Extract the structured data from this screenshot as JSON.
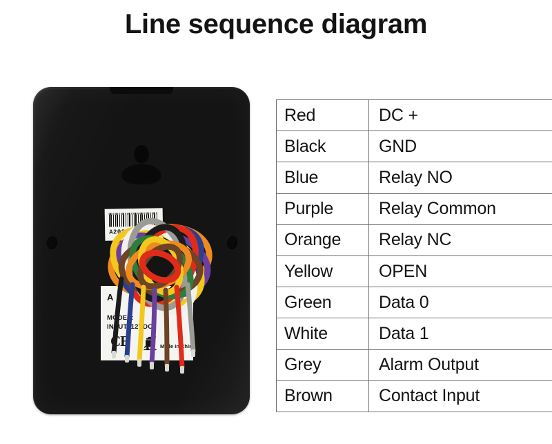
{
  "title": "Line sequence diagram",
  "device": {
    "name": "access-control-reader-back",
    "body_color": "#141414",
    "barcode_label": {
      "serial": "A202"
    },
    "spec_label": {
      "brand": "A",
      "model": "MODEL:",
      "input": "INPUT: 12VDC",
      "ce_mark": "CE",
      "weee_icon": "crossed-out-wheelie-bin-icon",
      "origin": "Made in China"
    },
    "wires": [
      {
        "color_name": "Red",
        "hex": "#e02b1b"
      },
      {
        "color_name": "Black",
        "hex": "#1b1b1b"
      },
      {
        "color_name": "Blue",
        "hex": "#2b3f8f"
      },
      {
        "color_name": "Purple",
        "hex": "#6b3fa0"
      },
      {
        "color_name": "Orange",
        "hex": "#ef8a1f"
      },
      {
        "color_name": "Yellow",
        "hex": "#f2c81e"
      },
      {
        "color_name": "Green",
        "hex": "#2f7d3a"
      },
      {
        "color_name": "White",
        "hex": "#f0f0ec"
      },
      {
        "color_name": "Grey",
        "hex": "#9b9b96"
      },
      {
        "color_name": "Brown",
        "hex": "#6e4326"
      }
    ]
  },
  "table": {
    "rows": [
      {
        "color": "Red",
        "function": "DC +"
      },
      {
        "color": "Black",
        "function": "GND"
      },
      {
        "color": "Blue",
        "function": "Relay NO"
      },
      {
        "color": "Purple",
        "function": "Relay Common"
      },
      {
        "color": "Orange",
        "function": "Relay NC"
      },
      {
        "color": "Yellow",
        "function": "OPEN"
      },
      {
        "color": "Green",
        "function": "Data 0"
      },
      {
        "color": "White",
        "function": "Data 1"
      },
      {
        "color": "Grey",
        "function": "Alarm Output"
      },
      {
        "color": "Brown",
        "function": "Contact Input"
      }
    ]
  }
}
